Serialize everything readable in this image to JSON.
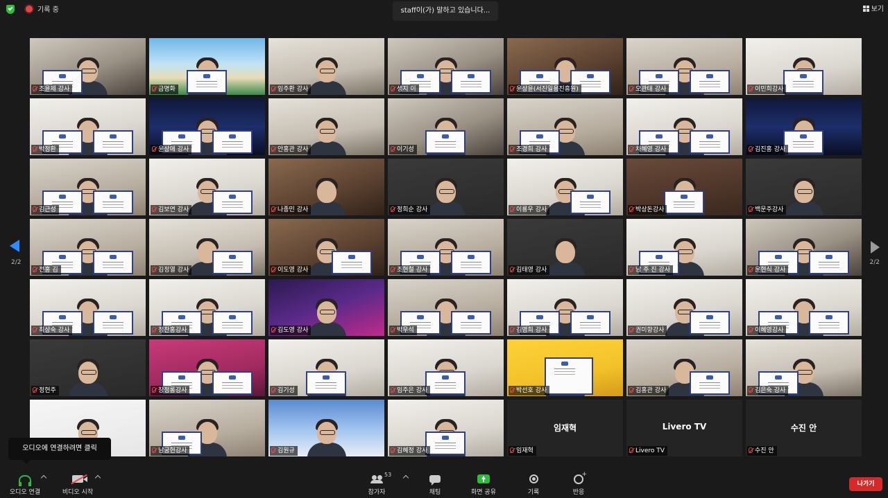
{
  "topbar": {
    "recording_label": "기록 중",
    "speaking_label": "staff이(가) 말하고 있습니다...",
    "view_label": "보기"
  },
  "paging": {
    "left": "2/2",
    "right": "2/2"
  },
  "tooltip": "오디오에 연결하려면 클릭",
  "participants": [
    "조윤제 강사",
    "금명화",
    "임주환 강사",
    "생지 이",
    "윤상윤(서진일용진흥원)",
    "오관태 강사",
    "이민희강사",
    "박정환",
    "윤상애 강사",
    "안홍관 강사",
    "이기성",
    "조경희 강사",
    "차혜영 강사",
    "김진홍 강사",
    "김근성",
    "김보연 강사",
    "나종민 강사",
    "정희순 강사",
    "이룡우 강사",
    "박상돈강사",
    "백문주강사",
    "전홍 김",
    "김정열 강사",
    "이도영 강사",
    "조현철 강사",
    "김태영 강사",
    "남 주 진 강사",
    "윤현식 강사",
    "최상숙 강사",
    "정찬홍강사",
    "김도영 강사",
    "박우석",
    "김영희 강사",
    "권미향강사",
    "이혜영강사",
    "정현주",
    "장정롱강사",
    "김기성",
    "임주은 강사",
    "박선호 강사",
    "김홍관 강사",
    "김은숙 강사",
    "",
    "남궁현강사",
    "김원규",
    "김혜정 강사",
    "임재혁",
    "Livero TV",
    "수진 안"
  ],
  "no_video_names": {
    "46": "임재혁",
    "47": "Livero TV",
    "48": "수진 안"
  },
  "toolbar": {
    "audio": "오디오 연결",
    "video": "비디오 시작",
    "participants": "참가자",
    "participant_count": "53",
    "chat": "채팅",
    "share": "화면 공유",
    "record": "기록",
    "reactions": "반응",
    "leave": "나가기"
  },
  "colors": {
    "share_green": "#2dbd3a",
    "leave_red": "#d42a2a",
    "nav_blue": "#2d8cff"
  }
}
